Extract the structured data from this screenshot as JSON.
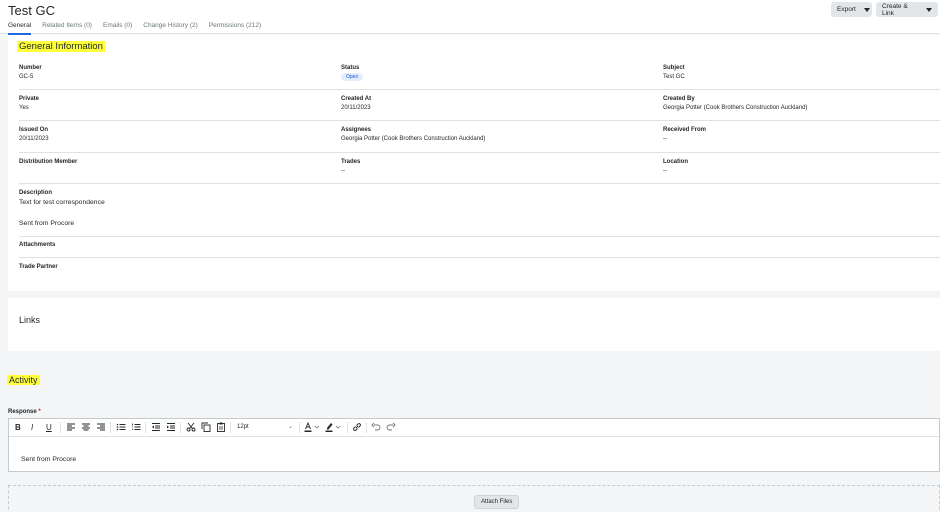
{
  "header": {
    "title": "Test GC",
    "tabs": [
      {
        "label": "General"
      },
      {
        "label": "Related Items (0)"
      },
      {
        "label": "Emails (0)"
      },
      {
        "label": "Change History (2)"
      },
      {
        "label": "Permissions (212)"
      }
    ],
    "active_tab": "General",
    "export_label": "Export",
    "create_link_label": "Create & Link"
  },
  "general_info": {
    "title": "General Information",
    "fields": {
      "number": {
        "label": "Number",
        "value": "GC-5"
      },
      "status": {
        "label": "Status",
        "value": "Open"
      },
      "subject": {
        "label": "Subject",
        "value": "Test GC"
      },
      "private": {
        "label": "Private",
        "value": "Yes"
      },
      "created_at": {
        "label": "Created At",
        "value": "20/11/2023"
      },
      "created_by": {
        "label": "Created By",
        "value": "Georgia Potter (Cook Brothers Construction Auckland)"
      },
      "issued_on": {
        "label": "Issued On",
        "value": "20/11/2023"
      },
      "assignees": {
        "label": "Assignees",
        "value": "Georgia Potter (Cook Brothers Construction Auckland)"
      },
      "received_from": {
        "label": "Received From",
        "value": "--"
      },
      "distribution_member": {
        "label": "Distribution Member"
      },
      "trades": {
        "label": "Trades",
        "value": "--"
      },
      "location": {
        "label": "Location",
        "value": "--"
      },
      "description": {
        "label": "Description",
        "line1": "Text for test correspondence",
        "line2": "Sent from Procore"
      },
      "attachments": {
        "label": "Attachments"
      },
      "trade_partner": {
        "label": "Trade Partner"
      }
    }
  },
  "links": {
    "title": "Links"
  },
  "activity": {
    "title": "Activity",
    "response_label": "Response",
    "required_mark": "*",
    "toolbar": {
      "bold": "B",
      "italic": "I",
      "underline": "U",
      "font_size": "12pt"
    },
    "editor_text": "Sent from Procore",
    "attach_label": "Attach Files"
  },
  "colors": {
    "highlight": "#ffff3a",
    "status_pill_bg": "#e1ecfc",
    "status_pill_text": "#1d5cc9",
    "active_tab_underline": "#2066df",
    "required": "#d40e16"
  }
}
